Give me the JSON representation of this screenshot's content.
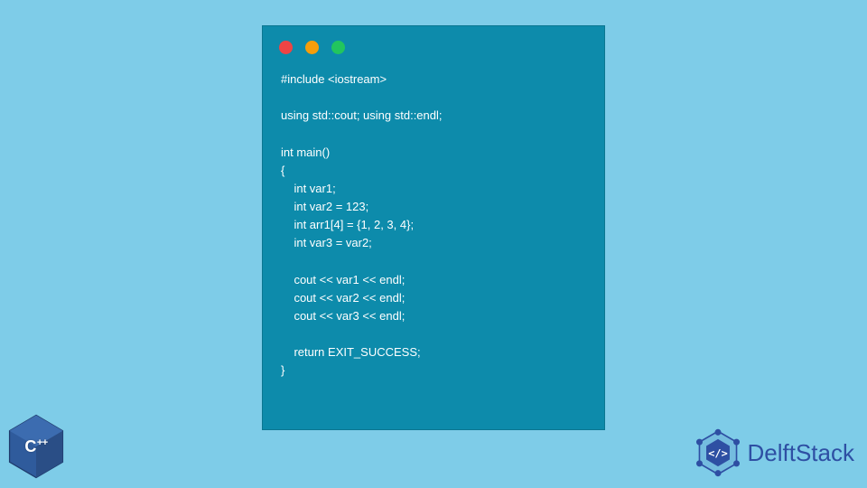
{
  "code": {
    "lines": [
      "#include <iostream>",
      "",
      "using std::cout; using std::endl;",
      "",
      "int main()",
      "{",
      "    int var1;",
      "    int var2 = 123;",
      "    int arr1[4] = {1, 2, 3, 4};",
      "    int var3 = var2;",
      "",
      "    cout << var1 << endl;",
      "    cout << var2 << endl;",
      "    cout << var3 << endl;",
      "",
      "    return EXIT_SUCCESS;",
      "}"
    ]
  },
  "badge": {
    "label": "C",
    "plus": "++"
  },
  "brand": {
    "name": "DelftStack"
  },
  "colors": {
    "page_bg": "#7ecce8",
    "window_bg": "#0d8bab",
    "code_text": "#ffffff",
    "brand_text": "#2e4fa3",
    "brand_logo": "#2e4fa3"
  }
}
